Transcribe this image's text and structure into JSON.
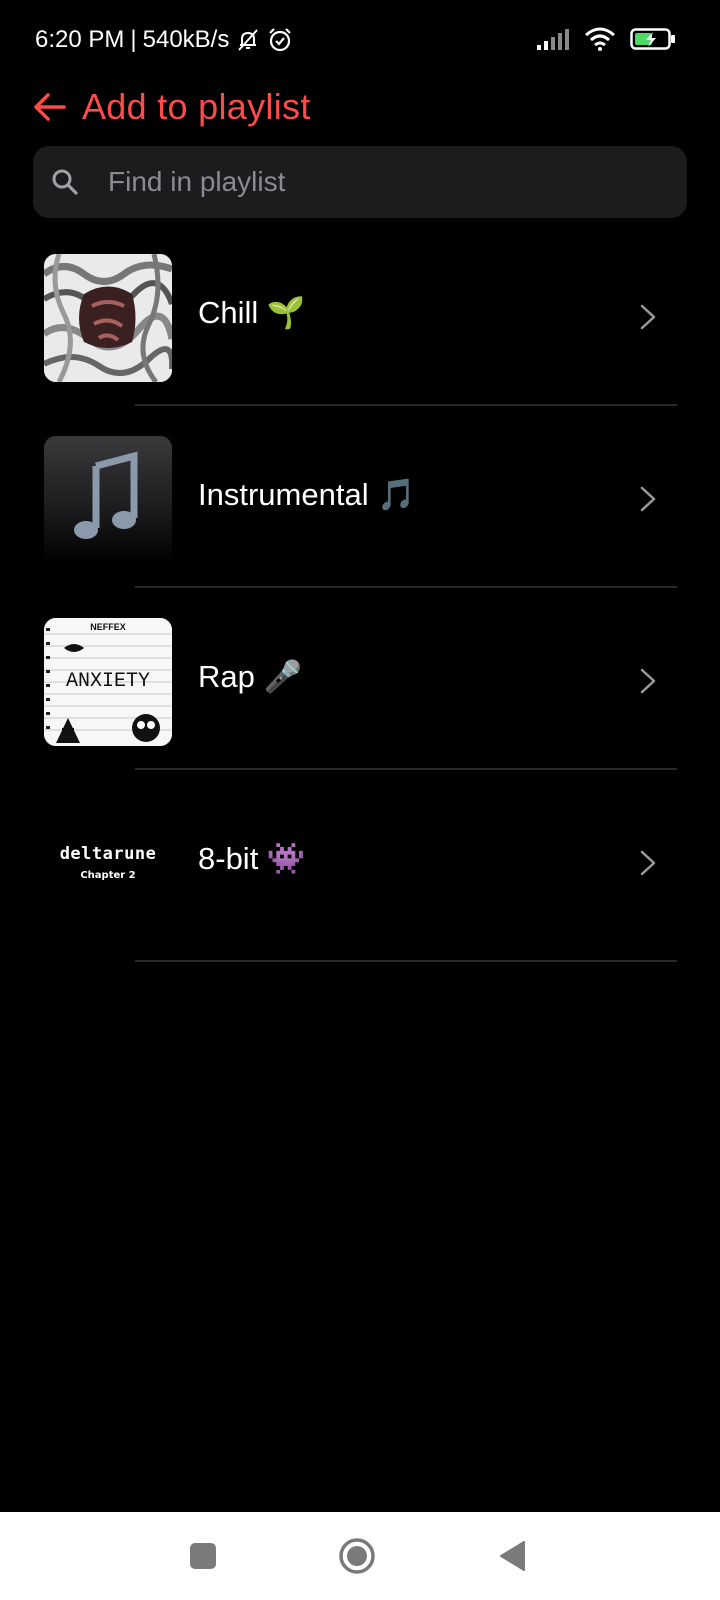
{
  "status": {
    "time": "6:20 PM",
    "separator": "|",
    "speed": "540kB/s",
    "battery_color": "#4cd964"
  },
  "header": {
    "title": "Add to playlist",
    "accent_color": "#ff4a4a"
  },
  "search": {
    "placeholder": "Find in playlist",
    "value": ""
  },
  "playlists": [
    {
      "name": "Chill 🌱",
      "thumb": "chill-cover"
    },
    {
      "name": "Instrumental 🎵",
      "thumb": "music-note-cover"
    },
    {
      "name": "Rap 🎤",
      "thumb": "anxiety-cover",
      "cover_text": "ANXIETY",
      "cover_artist": "NEFFEX"
    },
    {
      "name": "8-bit 👾",
      "thumb": "deltarune-cover",
      "cover_text": "deltarune",
      "cover_sub": "Chapter 2"
    }
  ]
}
